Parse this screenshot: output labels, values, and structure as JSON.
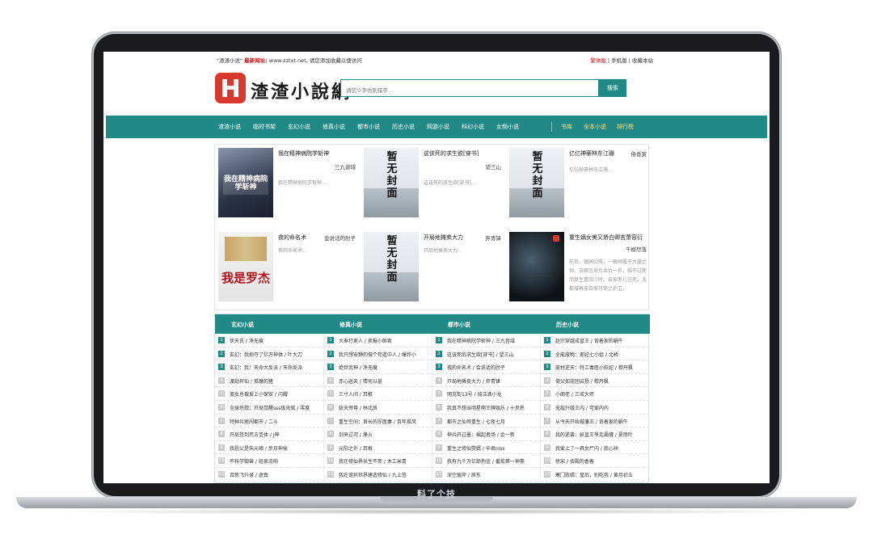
{
  "laptop": {
    "brand_label": "料了个技"
  },
  "topbar": {
    "site_name": "\"渣渣小说\"",
    "new_url_label": "最新网址:",
    "url": "www.zztxt.net,",
    "tip": "请您添加收藏以便访问",
    "links": [
      "繁体版",
      "手机版",
      "收藏本站"
    ]
  },
  "header": {
    "logo_text": "渣渣小說網",
    "search_placeholder": "请您少字也别错字...",
    "search_button": "搜索"
  },
  "nav": {
    "items": [
      "渣渣小说",
      "临时书架",
      "玄幻小说",
      "修真小说",
      "都市小说",
      "历史小说",
      "网游小说",
      "科幻小说",
      "女频小说"
    ],
    "right_items": [
      "书库",
      "全本小说",
      "排行榜"
    ]
  },
  "featured": [
    {
      "title": "我在精神病院学斩神",
      "author": "三九音域",
      "desc": "我在精神病院学斩神..."
    },
    {
      "title": "这该死的求生欲[穿书]",
      "author": "望三山",
      "desc": "这该死的求生欲[穿书]..."
    },
    {
      "title": "亿亿神豪林东江珊",
      "author": "倦香寅",
      "desc": "亿亿神豪林东江珊..."
    },
    {
      "title": "夜的命名术",
      "author": "会说话的肘子",
      "desc": "夜的命名术..."
    },
    {
      "title": "开局地摊卖大力",
      "author": "弃青锋",
      "desc": "开局地摊卖大力..."
    },
    {
      "title": "重生嫡女美又娇白卿言萧容衍",
      "author": "千桦尽落",
      "desc": "前世，镇国公府，一朝倾覆于大厦之倾。白卿言身负血仇一世，临不过死而复生重回少时。白家男儿已死，大都城再无白家可倚之护卫。"
    }
  ],
  "covers": {
    "no_cover_text": "暂无封面",
    "cover1_title": "我在精神病院学斩神",
    "cover4_title": "我是罗杰"
  },
  "lists": {
    "headers": [
      "玄幻小说",
      "修真小说",
      "都市小说",
      "历史小说"
    ],
    "columns": [
      [
        "伏天氏 / 净无痕",
        "玄幻：我掠夺了亿万神体 / 叶大刀",
        "玄幻：我！天命大反派 / 天命反派",
        "渡劫异仙 / 孤魔的猪",
        "美女总裁爱上小保安 / 闪耀",
        "全球杀戮：开局觉醒sss级天赋 / 零度",
        "特种兵痞闯都市 / 二斗",
        "开局签到荒古圣体 / J神",
        "我祖父是朱元璋 / 步月神偷",
        "不科学御兽 / 轻泉流响",
        "百炼飞升录 / 虚真"
      ],
      [
        "大奉打更人 / 卖报小郎君",
        "我只想安静的做个苟道中人 / 爆炸小",
        "绝世武神 / 净无痕",
        "赤心巡天 / 情何以甚",
        "三寸人间 / 耳根",
        "妖天帝尊 / 林北辰",
        "重生空间：首长的军医妻 / 百年孤风",
        "剑来过河 / 烽火",
        "元阳之外 / 耳根",
        "我在修仙界长生不死 / 木工米青",
        "我在诡异世界建造修仙 / 九上签"
      ],
      [
        "我在精神病院学斩神 / 三九音域",
        "这该死的求生欲[穿书] / 望三山",
        "夜的命名术 / 会说话的肘子",
        "开局地摊卖大力 / 弃青锋",
        "明克街13号 / 纯洁滴小龙",
        "我真不想当明星啊王牌娱乐 / 十步杀",
        "都市之仙帝重生 / 七夜七月",
        "神兵开过墨：崛起者场 / 金一新",
        "重生之修仙赘婿 / 辛君niss",
        "我有九千万亿舔狗金 / 番茄第一神豪",
        "深空彼岸 / 辰东"
      ],
      [
        "赵宗穿越成皇王 / 背着家的蜗牛",
        "全能废物：邪妃七小姐 / 北桥",
        "废材逆天：特工毒医小狂妃 / 穆丹枫",
        "倚父如花团云扬 / 穆丹枫",
        "小阁老 / 三戒大师",
        "无敌升级王内 / 可爱内内",
        "从今天开始做藩王 / 背着家的蜗牛",
        "我的逆袭：妖皇王爷走霸缠 / 夏丽叶",
        "我爱上了一具女尸内 / 我心祥",
        "徐宋 / 佰殿的香客",
        "寒门败婿：皇后，别吃我 / 黄月初五"
      ]
    ]
  },
  "colors": {
    "accent": "#218a86",
    "red": "#d01818",
    "logo": "#d8392c"
  }
}
